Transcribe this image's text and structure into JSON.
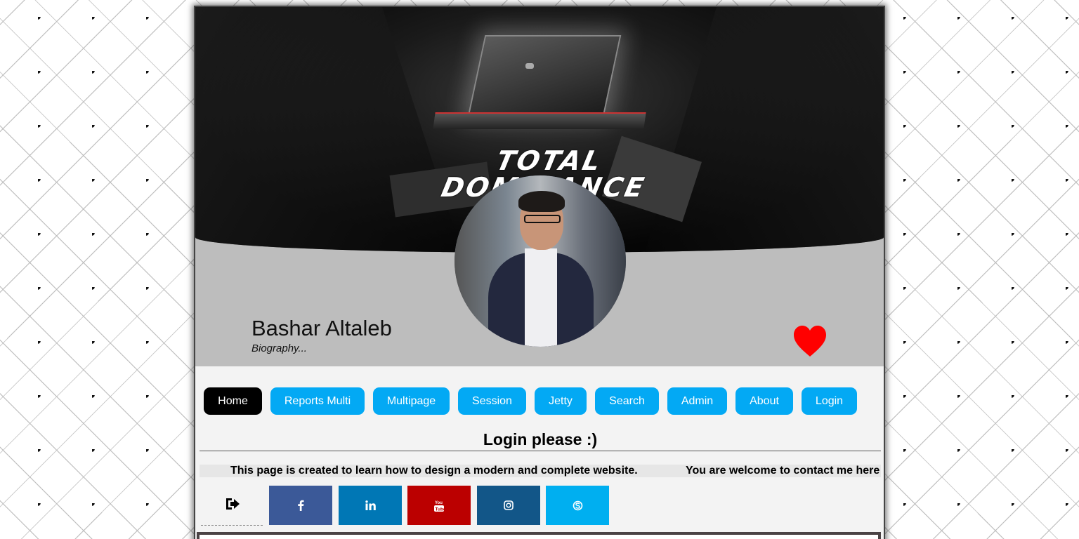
{
  "banner": {
    "title_line1": "TOTAL",
    "title_line2": "DOMINANCE"
  },
  "profile": {
    "name": "Bashar Altaleb",
    "bio": "Biography..."
  },
  "nav": {
    "items": [
      {
        "label": "Home",
        "active": true
      },
      {
        "label": "Reports Multi",
        "active": false
      },
      {
        "label": "Multipage",
        "active": false
      },
      {
        "label": "Session",
        "active": false
      },
      {
        "label": "Jetty",
        "active": false
      },
      {
        "label": "Search",
        "active": false
      },
      {
        "label": "Admin",
        "active": false
      },
      {
        "label": "About",
        "active": false
      },
      {
        "label": "Login",
        "active": false
      }
    ]
  },
  "main": {
    "heading": "Login please :)",
    "marquee": "This page is created to learn how to design a modern and complete website.",
    "contact": "You are welcome to contact me here"
  },
  "social": [
    {
      "icon": "facebook-icon",
      "color": "#3b5998"
    },
    {
      "icon": "linkedin-icon",
      "color": "#0077b5"
    },
    {
      "icon": "youtube-icon",
      "color": "#bb0000"
    },
    {
      "icon": "instagram-icon",
      "color": "#125688"
    },
    {
      "icon": "skype-icon",
      "color": "#00aff0"
    }
  ],
  "colors": {
    "nav_button": "#03a9f4",
    "nav_active": "#000000",
    "heart": "#ff0000"
  }
}
